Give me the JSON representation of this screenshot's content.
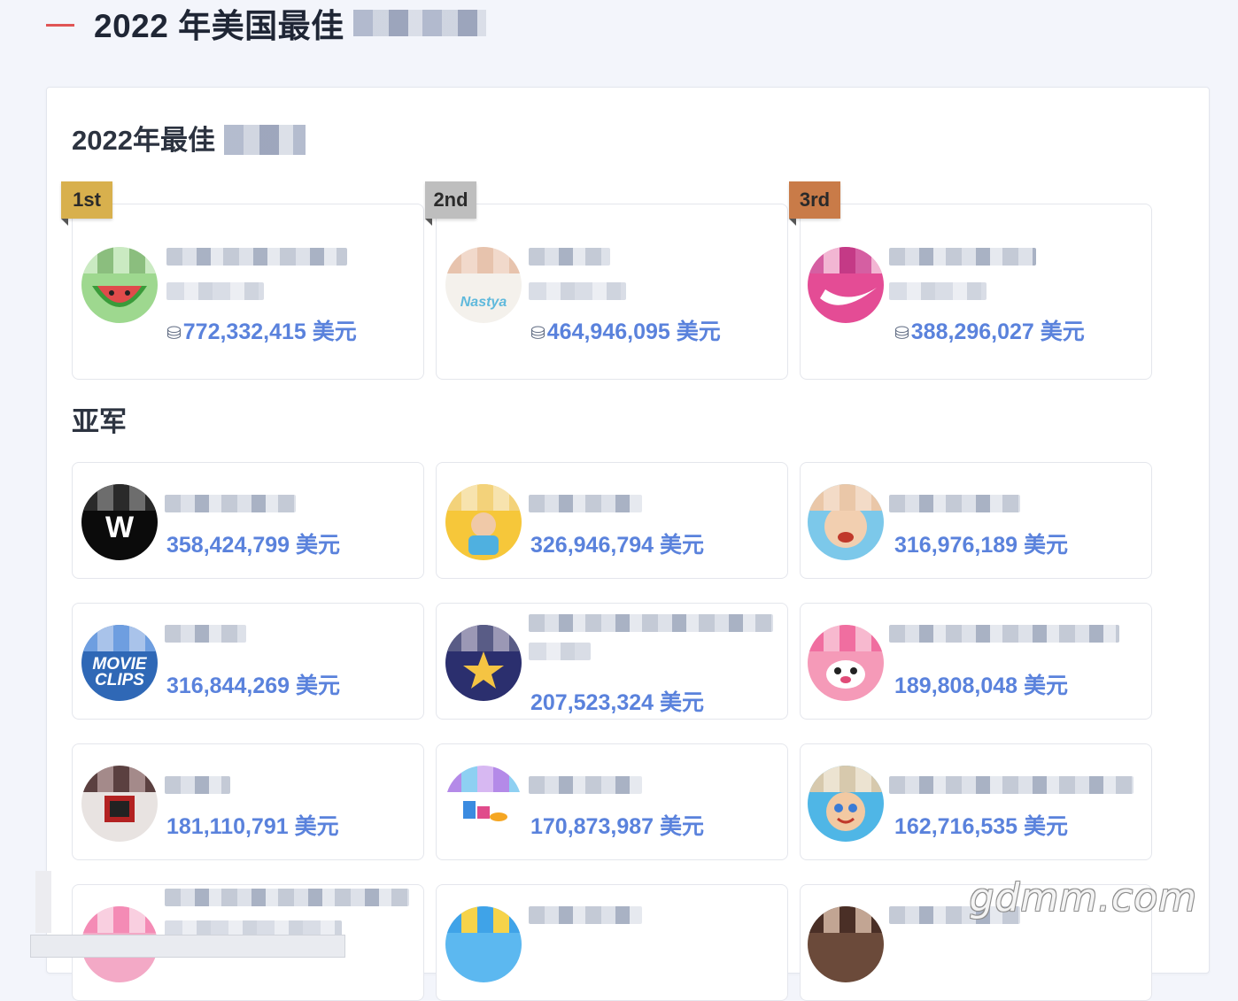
{
  "page": {
    "title": "2022 年美国最佳"
  },
  "sections": {
    "top3_title": "2022年最佳",
    "runners_title": "亚军"
  },
  "top3": [
    {
      "rank": "1st",
      "amount": "772,332,415 美元",
      "avatar_color": "#d34a4a"
    },
    {
      "rank": "2nd",
      "amount": "464,946,095 美元",
      "avatar_color": "#5fb9dc"
    },
    {
      "rank": "3rd",
      "amount": "388,296,027 美元",
      "avatar_color": "#d24a93"
    }
  ],
  "runners": [
    {
      "amount": "358,424,799 美元",
      "icon_text": "W"
    },
    {
      "amount": "326,946,794 美元"
    },
    {
      "amount": "316,976,189 美元"
    },
    {
      "amount": "316,844,269 美元",
      "icon_text": "MOVIE CLIPS"
    },
    {
      "amount": "207,523,324 美元"
    },
    {
      "amount": "189,808,048 美元"
    },
    {
      "amount": "181,110,791 美元"
    },
    {
      "amount": "170,873,987 美元"
    },
    {
      "amount": "162,716,535 美元"
    }
  ],
  "coin_icon": "coins-icon",
  "watermark": "gdmm.com"
}
